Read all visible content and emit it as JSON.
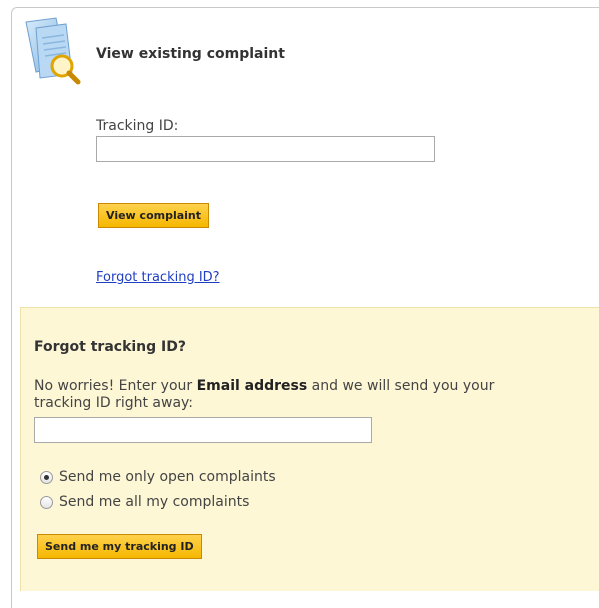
{
  "view_section": {
    "title": "View existing complaint",
    "tracking_label": "Tracking ID:",
    "tracking_value": "",
    "view_button": "View complaint",
    "forgot_link": "Forgot tracking ID?"
  },
  "forgot_section": {
    "title": "Forgot tracking ID?",
    "desc_before": "No worries! Enter your ",
    "desc_bold": "Email address",
    "desc_after": " and we will send you your tracking ID right away:",
    "email_value": "",
    "options": [
      {
        "label": "Send me only open complaints",
        "checked": true
      },
      {
        "label": "Send me all my complaints",
        "checked": false
      }
    ],
    "send_button": "Send me my tracking ID"
  },
  "colors": {
    "button_gradient_top": "#ffd24d",
    "button_gradient_bottom": "#f5b700",
    "forgot_box_bg": "#fdf7d6",
    "link": "#1f3fc2"
  },
  "icons": {
    "header_icon": "document-search-icon"
  }
}
